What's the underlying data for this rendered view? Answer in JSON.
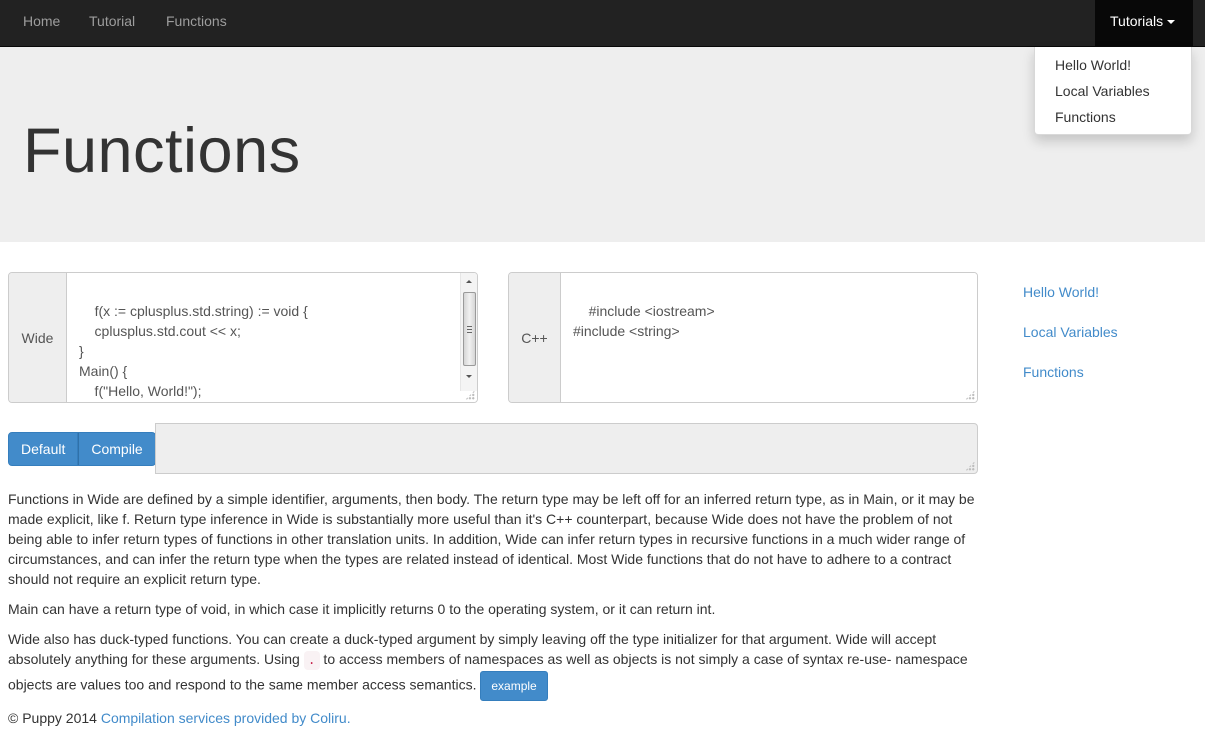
{
  "navbar": {
    "links": [
      "Home",
      "Tutorial",
      "Functions"
    ],
    "dropdown_label": "Tutorials",
    "dropdown_items": [
      "Hello World!",
      "Local Variables",
      "Functions"
    ]
  },
  "header": {
    "title": "Functions"
  },
  "editors": {
    "wide": {
      "label": "Wide",
      "code": "f(x := cplusplus.std.string) := void {\n    cplusplus.std.cout << x;\n}\nMain() {\n    f(\"Hello, World!\");\n}"
    },
    "cpp": {
      "label": "C++",
      "code": "#include <iostream>\n#include <string>"
    }
  },
  "actions": {
    "default_label": "Default",
    "compile_label": "Compile",
    "output_value": ""
  },
  "sidebar": {
    "links": [
      "Hello World!",
      "Local Variables",
      "Functions"
    ]
  },
  "content": {
    "p1": "Functions in Wide are defined by a simple identifier, arguments, then body. The return type may be left off for an inferred return type, as in Main, or it may be made explicit, like f. Return type inference in Wide is substantially more useful than it's C++ counterpart, because Wide does not have the problem of not being able to infer return types of functions in other translation units. In addition, Wide can infer return types in recursive functions in a much wider range of circumstances, and can infer the return type when the types are related instead of identical. Most Wide functions that do not have to adhere to a contract should not require an explicit return type.",
    "p2": "Main can have a return type of void, in which case it implicitly returns 0 to the operating system, or it can return int.",
    "p3_before": "Wide also has duck-typed functions. You can create a duck-typed argument by simply leaving off the type initializer for that argument. Wide will accept absolutely anything for these arguments. Using ",
    "p3_code": ".",
    "p3_after": " to access members of namespaces as well as objects is not simply a case of syntax re-use- namespace objects are values too and respond to the same member access semantics. ",
    "example_label": "example"
  },
  "footer": {
    "copyright": "© Puppy 2014 ",
    "link": "Compilation services provided by Coliru."
  },
  "colors": {
    "navbar_bg": "#222222",
    "accent": "#428bca",
    "jumbotron_bg": "#eeeeee",
    "code_color": "#c7254e"
  }
}
